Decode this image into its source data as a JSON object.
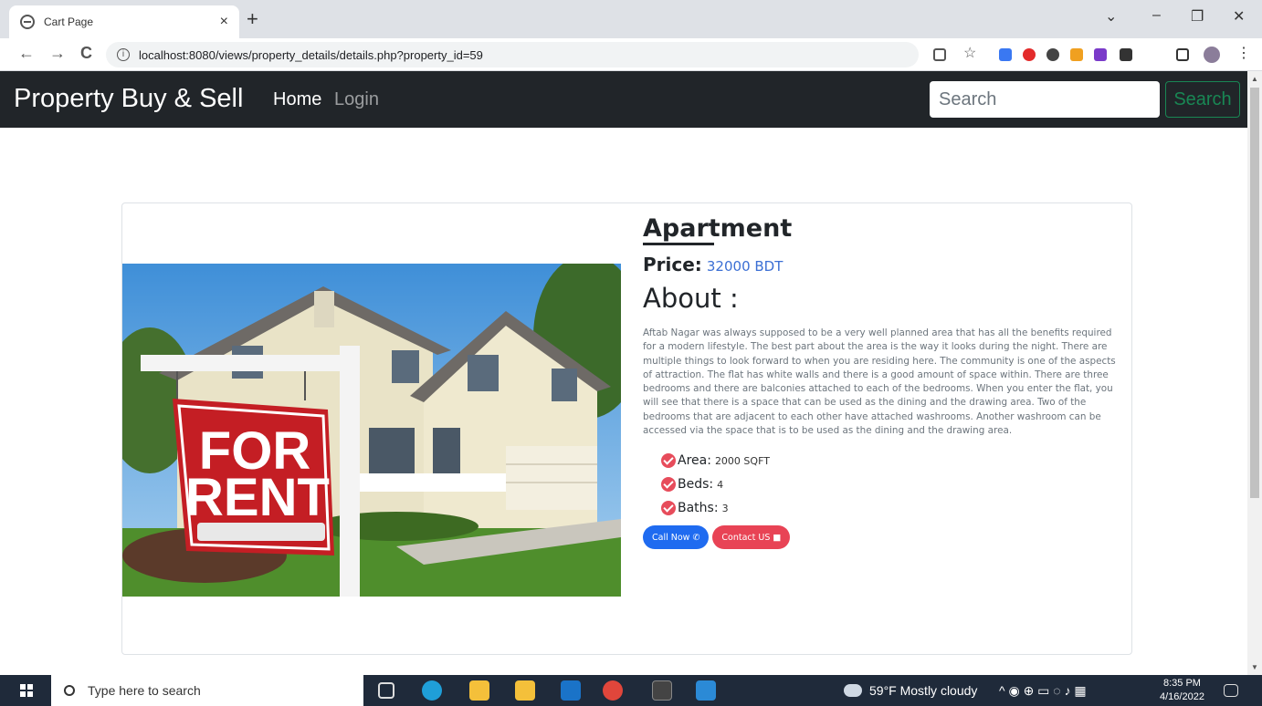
{
  "browser": {
    "tab_title": "Cart Page",
    "tab_close": "×",
    "new_tab": "+",
    "url": "localhost:8080/views/property_details/details.php?property_id=59",
    "info_glyph": "i",
    "back": "←",
    "forward": "→",
    "reload": "C",
    "win_dropdown": "⌄",
    "win_minimize": "–",
    "win_restore": "❐",
    "win_close": "✕"
  },
  "navbar": {
    "brand": "Property Buy & Sell",
    "home": "Home",
    "login": "Login",
    "search_placeholder": "Search",
    "search_button": "Search"
  },
  "property": {
    "title": "Apartment",
    "price_label": "Price:",
    "price_value": "32000 BDT",
    "about_heading": "About :",
    "description": "Aftab Nagar was always supposed to be a very well planned area that has all the benefits required for a modern lifestyle. The best part about the area is the way it looks during the night. There are multiple things to look forward to when you are residing here. The community is one of the aspects of attraction. The flat has white walls and there is a good amount of space within. There are three bedrooms and there are balconies attached to each of the bedrooms. When you enter the flat, you will see that there is a space that can be used as the dining and the drawing area. Two of the bedrooms that are adjacent to each other have attached washrooms. Another washroom can be accessed via the space that is to be used as the dining and the drawing area.",
    "features": [
      {
        "label": "Area:",
        "value": "2000 SQFT"
      },
      {
        "label": "Beds:",
        "value": "4"
      },
      {
        "label": "Baths:",
        "value": "3"
      }
    ],
    "call_button": "Call Now",
    "contact_button": "Contact US",
    "sign_text_line1": "FOR",
    "sign_text_line2": "RENT"
  },
  "taskbar": {
    "search_placeholder": "Type here to search",
    "weather": "59°F  Mostly cloudy",
    "time": "8:35 PM",
    "date": "4/16/2022"
  },
  "colors": {
    "navbar_bg": "#212529",
    "search_green": "#198754",
    "call_blue": "#1f6bf0",
    "contact_red": "#e84355",
    "price_blue": "#3b6fd4"
  }
}
